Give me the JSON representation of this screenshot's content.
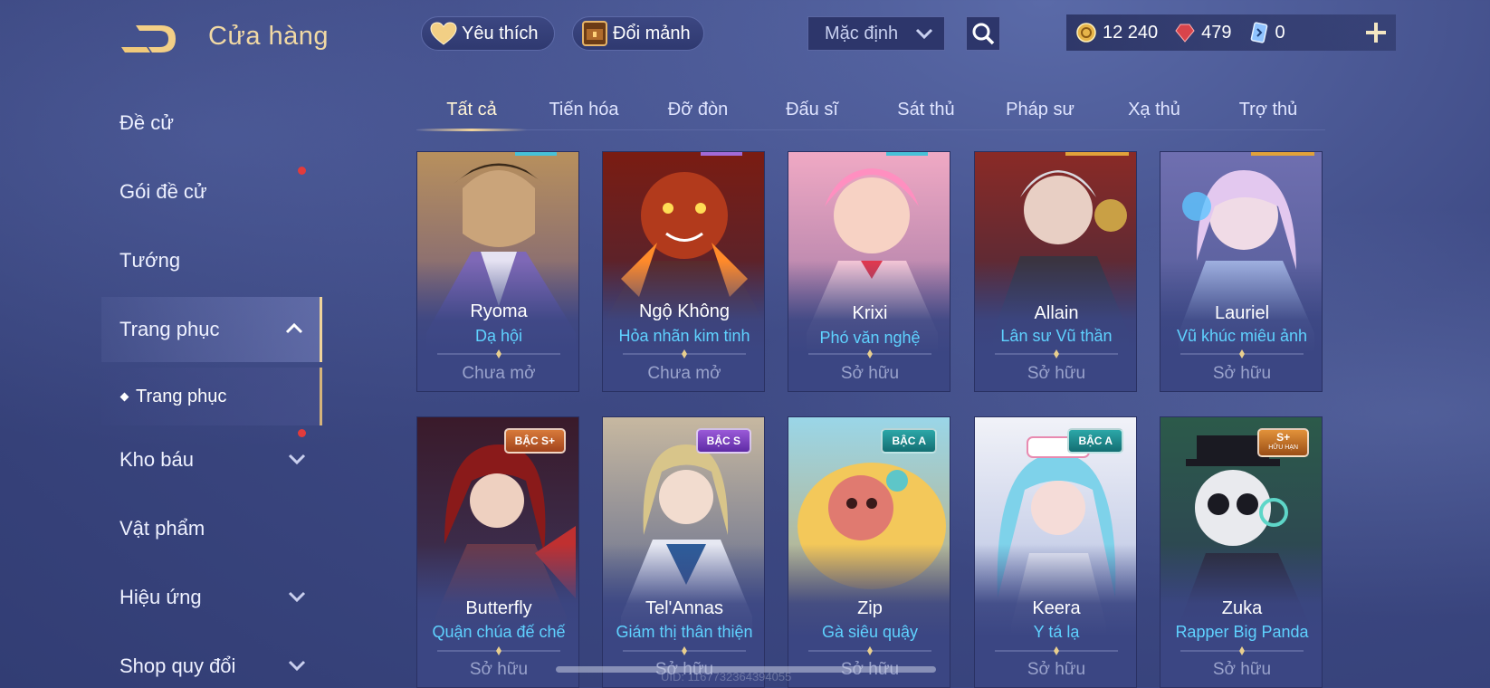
{
  "header": {
    "title": "Cửa hàng",
    "favorites_label": "Yêu thích",
    "exchange_label": "Đổi mảnh",
    "sort_value": "Mặc định"
  },
  "currency": {
    "gold": "12 240",
    "gems": "479",
    "vouchers": "0"
  },
  "sidebar": {
    "items": [
      {
        "label": "Đề cử"
      },
      {
        "label": "Gói đề cử"
      },
      {
        "label": "Tướng"
      },
      {
        "label": "Trang phục"
      },
      {
        "label": "Kho báu"
      },
      {
        "label": "Vật phẩm"
      },
      {
        "label": "Hiệu ứng"
      },
      {
        "label": "Shop quy đổi"
      }
    ],
    "sub_item": "Trang phục"
  },
  "tabs": [
    "Tất cả",
    "Tiến hóa",
    "Đỡ đòn",
    "Đấu sĩ",
    "Sát thủ",
    "Pháp sư",
    "Xạ thủ",
    "Trợ thủ"
  ],
  "cards": [
    {
      "hero": "Ryoma",
      "skin": "Dạ hội",
      "status": "Chưa mở",
      "badge": ""
    },
    {
      "hero": "Ngộ Không",
      "skin": "Hỏa nhãn kim tinh",
      "status": "Chưa mở",
      "badge": ""
    },
    {
      "hero": "Krixi",
      "skin": "Phó văn nghệ",
      "status": "Sở hữu",
      "badge": ""
    },
    {
      "hero": "Allain",
      "skin": "Lân sư Vũ thần",
      "status": "Sở hữu",
      "badge": ""
    },
    {
      "hero": "Lauriel",
      "skin": "Vũ khúc miêu ảnh",
      "status": "Sở hữu",
      "badge": ""
    },
    {
      "hero": "Butterfly",
      "skin": "Quận chúa đế chế",
      "status": "Sở hữu",
      "badge": "BẬC S+"
    },
    {
      "hero": "Tel'Annas",
      "skin": "Giám thị thân thiện",
      "status": "Sở hữu",
      "badge": "BẬC S"
    },
    {
      "hero": "Zip",
      "skin": "Gà siêu quậy",
      "status": "Sở hữu",
      "badge": "BẬC A"
    },
    {
      "hero": "Keera",
      "skin": "Y tá lạ",
      "status": "Sở hữu",
      "badge": "BẬC A"
    },
    {
      "hero": "Zuka",
      "skin": "Rapper Big Panda",
      "status": "Sở hữu",
      "badge": "S+",
      "badge_sub": "HỮU HẠN"
    }
  ],
  "footer": {
    "uid": "UID: 1167732364394055"
  },
  "colors": {
    "accent_gold": "#f1d9a4",
    "skin_name": "#5fd2ff",
    "background": "#3f4b86"
  }
}
